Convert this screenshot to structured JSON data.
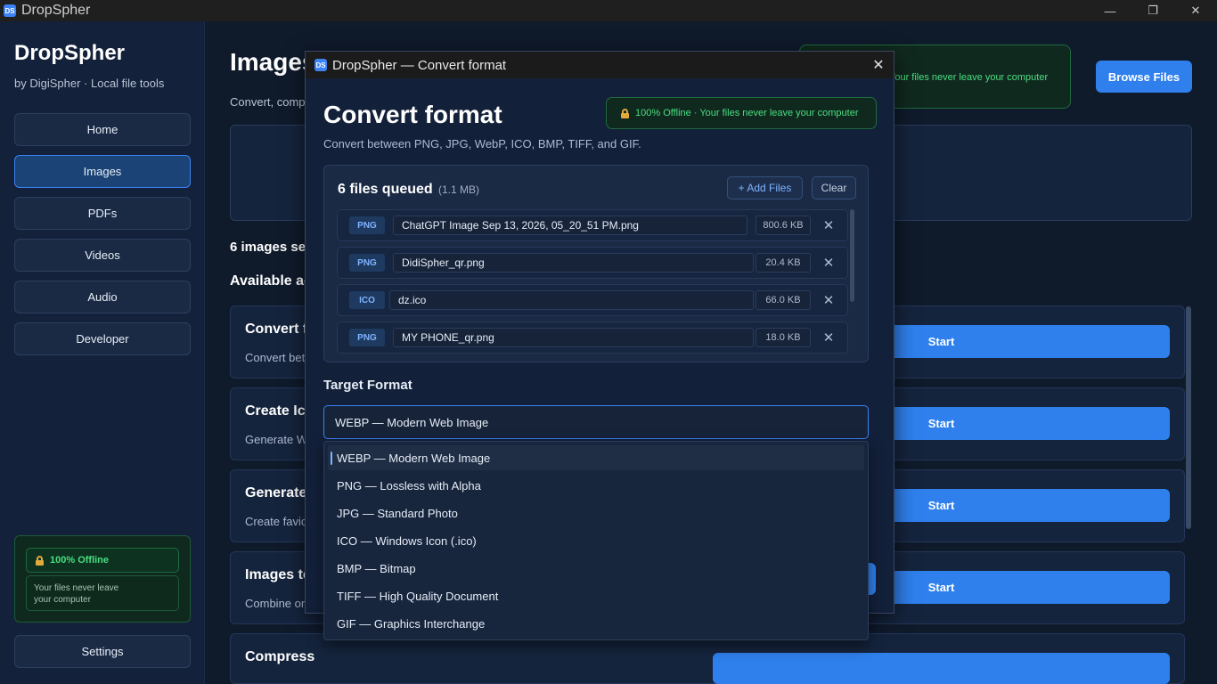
{
  "window": {
    "title": "DropSpher",
    "controls": [
      "—",
      "❐",
      "✕"
    ]
  },
  "sidebar": {
    "brand": "DropSpher",
    "subtitle": "by DigiSpher · Local file tools",
    "items": [
      {
        "label": "Home"
      },
      {
        "label": "Images",
        "active": true
      },
      {
        "label": "PDFs"
      },
      {
        "label": "Videos"
      },
      {
        "label": "Audio"
      },
      {
        "label": "Developer"
      }
    ],
    "offline_badge": "100% Offline",
    "offline_note_line1": "Your files never leave",
    "offline_note_line2": "your computer",
    "settings": "Settings"
  },
  "main": {
    "title": "Images",
    "subtitle": "Convert, comp",
    "offline_text": "Your files never leave your computer",
    "browse_button": "Browse Files",
    "selected_count": "6 images sele",
    "available_label": "Available ac",
    "actions": [
      {
        "title": "Convert f",
        "desc": "Convert bet",
        "button": "Start"
      },
      {
        "title": "Create Ico",
        "desc": "Generate W",
        "button": "Start"
      },
      {
        "title": "Generate",
        "desc": "Create favic",
        "button": "Start"
      },
      {
        "title": "Images to",
        "desc": "Combine or",
        "button": "Start"
      },
      {
        "title": "Compress",
        "desc": "",
        "button": ""
      }
    ]
  },
  "dialog": {
    "window_title": "DropSpher — Convert format",
    "close": "✕",
    "heading": "Convert format",
    "subtitle": "Convert between PNG, JPG, WebP, ICO, BMP, TIFF, and GIF.",
    "offline_text": "100% Offline · Your files never leave your computer",
    "queue": {
      "title": "6 files queued",
      "size": "(1.1 MB)",
      "add_button": "+ Add Files",
      "clear_button": "Clear",
      "files": [
        {
          "type": "PNG",
          "name": "ChatGPT Image Sep 13, 2026, 05_20_51 PM.png",
          "size": "800.6 KB"
        },
        {
          "type": "PNG",
          "name": "DidiSpher_qr.png",
          "size": "20.4 KB"
        },
        {
          "type": "ICO",
          "name": "dz.ico",
          "size": "66.0 KB"
        },
        {
          "type": "PNG",
          "name": "MY PHONE_qr.png",
          "size": "18.0 KB"
        }
      ],
      "remove_glyph": "✕"
    },
    "target_label": "Target Format",
    "target_value": "WEBP — Modern Web Image",
    "options": [
      "WEBP — Modern Web Image",
      "PNG — Lossless with Alpha",
      "JPG — Standard Photo",
      "ICO — Windows Icon (.ico)",
      "BMP — Bitmap",
      "TIFF — High Quality Document",
      "GIF — Graphics Interchange"
    ]
  },
  "colors": {
    "accent": "#2f80ed",
    "offline_green": "#4ade80",
    "bg": "#0f1a2b"
  }
}
